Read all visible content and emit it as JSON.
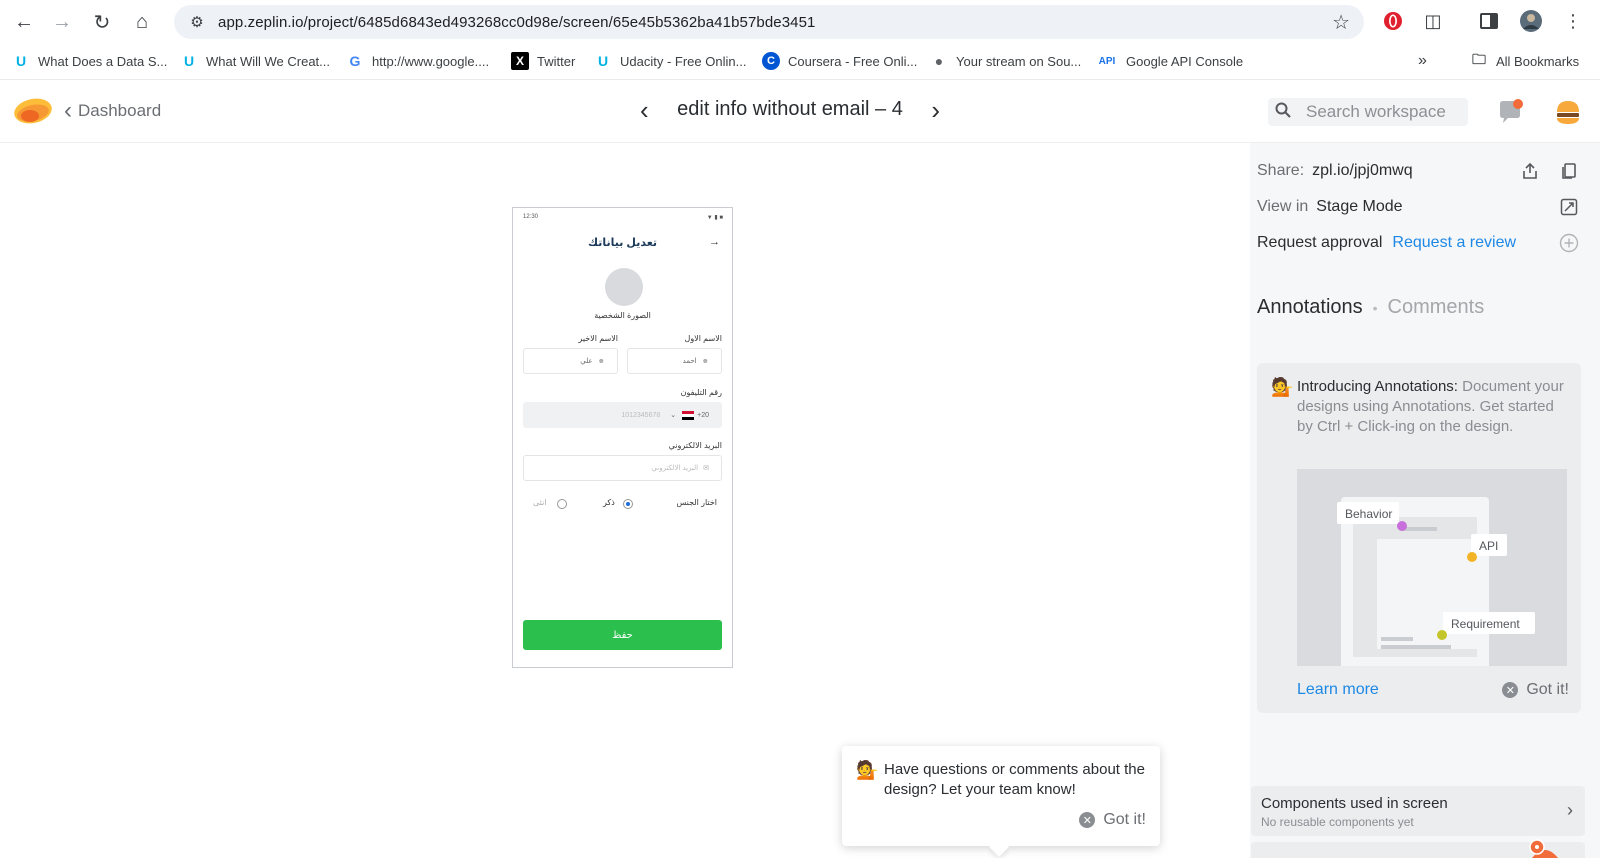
{
  "browser": {
    "url": "app.zeplin.io/project/6485d6843ed493268cc0d98e/screen/65e45b5362ba41b57bde3451",
    "bookmarks": [
      {
        "label": "What Does a Data S...",
        "icon": "udacity-icon"
      },
      {
        "label": "What Will We Creat...",
        "icon": "udacity-icon"
      },
      {
        "label": "http://www.google....",
        "icon": "google-icon"
      },
      {
        "label": "Twitter",
        "icon": "x-twitter-icon"
      },
      {
        "label": "Udacity - Free Onlin...",
        "icon": "udacity-icon"
      },
      {
        "label": "Coursera - Free Onli...",
        "icon": "coursera-icon"
      },
      {
        "label": "Your stream on Sou...",
        "icon": "globe-icon"
      },
      {
        "label": "Google API Console",
        "icon": "api-icon"
      }
    ],
    "bookmarks_overflow": "»",
    "all_bookmarks": "All Bookmarks"
  },
  "header": {
    "back_label": "Dashboard",
    "screen_title": "edit info without email – 4",
    "search_placeholder": "Search workspace"
  },
  "artboard": {
    "time": "12:30",
    "title": "تعديل بياناتك",
    "photo_label": "الصورة الشخصية",
    "first_name_label": "الاسم الاول",
    "first_name_value": "احمد",
    "last_name_label": "الاسم الاخير",
    "last_name_value": "علي",
    "phone_label": "رقم التليفون",
    "phone_code": "+20",
    "phone_placeholder": "1012345678",
    "email_label": "البريد الالكتروني",
    "email_placeholder": "البريد الالكتروني",
    "gender_label": "اختار الجنس",
    "gender_male": "ذكر",
    "gender_female": "انثى",
    "save_label": "حفظ"
  },
  "comment_tip": {
    "text": "Have questions or comments about the design? Let your team know!",
    "dismiss": "Got it!"
  },
  "sidebar": {
    "share_key": "Share:",
    "share_value": "zpl.io/jpj0mwq",
    "view_key": "View in",
    "view_value": "Stage Mode",
    "approval_key": "Request approval",
    "approval_link": "Request a review",
    "tab_annotations": "Annotations",
    "tab_sep": "•",
    "tab_comments": "Comments",
    "ann_title": "Introducing Annotations:",
    "ann_body": "Document your designs using Annotations. Get started by Ctrl + Click-ing on the design.",
    "illus_behavior": "Behavior",
    "illus_api": "API",
    "illus_requirement": "Requirement",
    "learn_more": "Learn more",
    "ann_dismiss": "Got it!",
    "components_title": "Components used in screen",
    "components_sub": "No reusable components yet"
  },
  "colors": {
    "accent_link": "#1e88e5",
    "save_button": "#2bbf4d",
    "notification": "#f26b3a"
  }
}
